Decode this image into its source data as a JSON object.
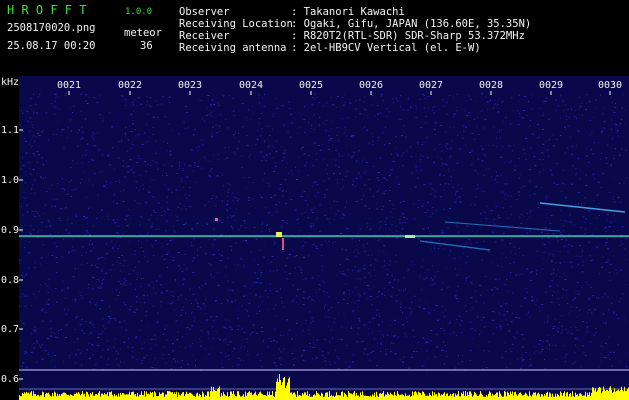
{
  "app": {
    "name": "H R O F F T",
    "version": "1.0.0"
  },
  "file": {
    "filename": "2508170020.png",
    "datetime": "25.08.17 00:20"
  },
  "meteor": {
    "label": "meteor",
    "count": "36"
  },
  "info": [
    {
      "key": "Observer",
      "value": ": Takanori Kawachi"
    },
    {
      "key": "Receiving Location",
      "value": ": Ogaki, Gifu, JAPAN (136.60E, 35.35N)"
    },
    {
      "key": "Receiver",
      "value": ": R820T2(RTL-SDR) SDR-Sharp 53.372MHz"
    },
    {
      "key": "Receiving antenna",
      "value": ": 2el-HB9CV Vertical (el. E-W)"
    }
  ],
  "axis": {
    "unit": "kHz",
    "time_ticks": [
      "0021",
      "0022",
      "0023",
      "0024",
      "0025",
      "0026",
      "0027",
      "0028",
      "0029",
      "0030"
    ],
    "freq_ticks": [
      "1.1",
      "1.0",
      "0.9",
      "0.8",
      "0.7",
      "0.6"
    ]
  },
  "colors": {
    "header_green": "#36e23a",
    "text_white": "#f4f4f4",
    "background": "#08084a",
    "carrier": "#3fd0c8",
    "level": "#ffff00"
  }
}
